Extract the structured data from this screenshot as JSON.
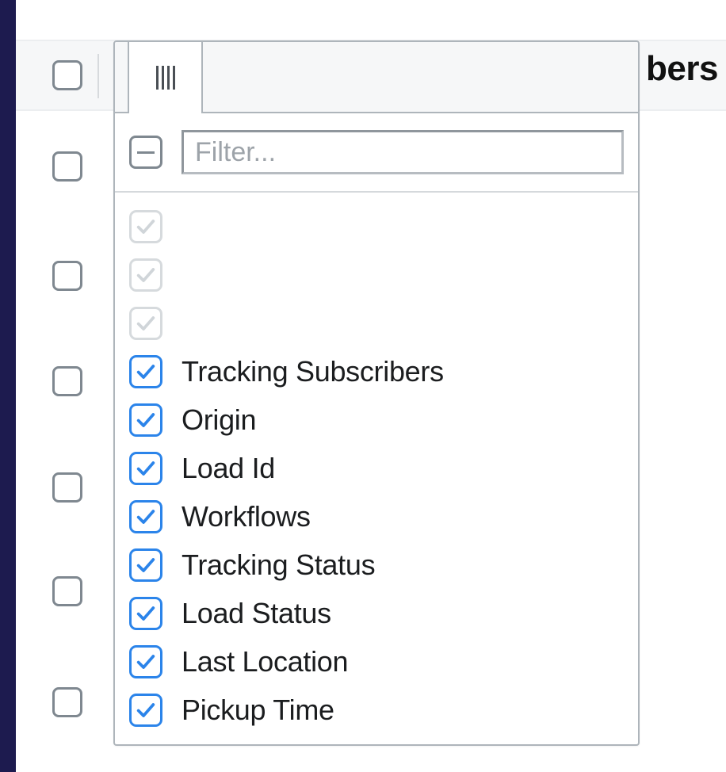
{
  "header": {
    "partial_text": "bers"
  },
  "filter": {
    "placeholder": "Filter..."
  },
  "columns": [
    {
      "label": "",
      "state": "disabled"
    },
    {
      "label": "",
      "state": "disabled"
    },
    {
      "label": "",
      "state": "disabled"
    },
    {
      "label": "Tracking Subscribers",
      "state": "checked"
    },
    {
      "label": "Origin",
      "state": "checked"
    },
    {
      "label": "Load Id",
      "state": "checked"
    },
    {
      "label": "Workflows",
      "state": "checked"
    },
    {
      "label": "Tracking Status",
      "state": "checked"
    },
    {
      "label": "Load Status",
      "state": "checked"
    },
    {
      "label": "Last Location",
      "state": "checked"
    },
    {
      "label": "Pickup Time",
      "state": "checked"
    }
  ],
  "background_row_checkbox_positions": [
    76,
    191,
    329,
    462,
    596,
    727,
    867
  ]
}
